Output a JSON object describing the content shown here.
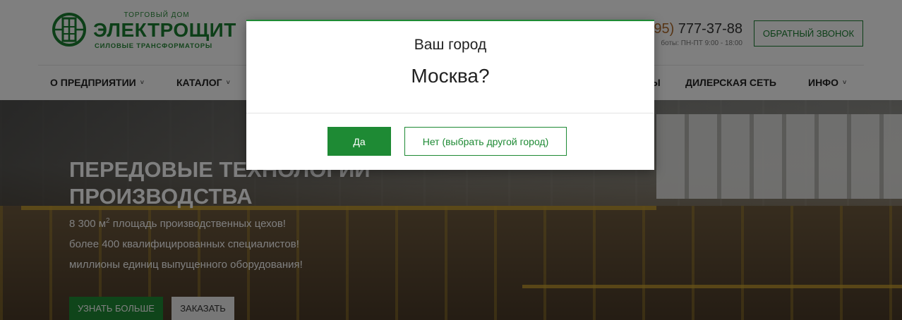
{
  "header": {
    "logo": {
      "small": "ТОРГОВЫЙ ДОМ",
      "big": "ЭЛЕКТРОЩИТ",
      "sub": "СИЛОВЫЕ ТРАНСФОРМАТОРЫ"
    },
    "phone_code": "95)",
    "phone_number": " 777-37-88",
    "hours": "боты: ПН-ПТ 9:00 - 18:00",
    "callback_label": "ОБРАТНЫЙ ЗВОНОК"
  },
  "nav": {
    "items": [
      {
        "label": "О ПРЕДПРИЯТИИ",
        "chevron": "˅"
      },
      {
        "label": "КАТАЛОГ",
        "chevron": "˅"
      },
      {
        "label": "Ы",
        "chevron": ""
      },
      {
        "label": "ДИЛЕРСКАЯ СЕТЬ",
        "chevron": ""
      },
      {
        "label": "ИНФО",
        "chevron": "˅"
      }
    ]
  },
  "hero": {
    "title": "ПЕРЕДОВЫЕ ТЕХНОЛОГИИ ПРОИЗВОДСТВА",
    "line1_pre": "8 300 м",
    "line1_sup": "2",
    "line1_post": " площадь производственных цехов!",
    "line2": "более 400 квалифицированных специалистов!",
    "line3": "миллионы единиц выпущенного оборудования!",
    "more_label": "УЗНАТЬ БОЛЬШЕ",
    "order_label": "ЗАКАЗАТЬ"
  },
  "modal": {
    "label": "Ваш город",
    "city": "Москва?",
    "yes_label": "Да",
    "no_label": "Нет (выбрать другой город)"
  },
  "colors": {
    "brand_green": "#1e8a34",
    "overlay": "rgba(0,0,0,0.5)"
  },
  "icons": {
    "logo": "electroshchit-logo-icon",
    "chevron": "chevron-down-icon"
  }
}
